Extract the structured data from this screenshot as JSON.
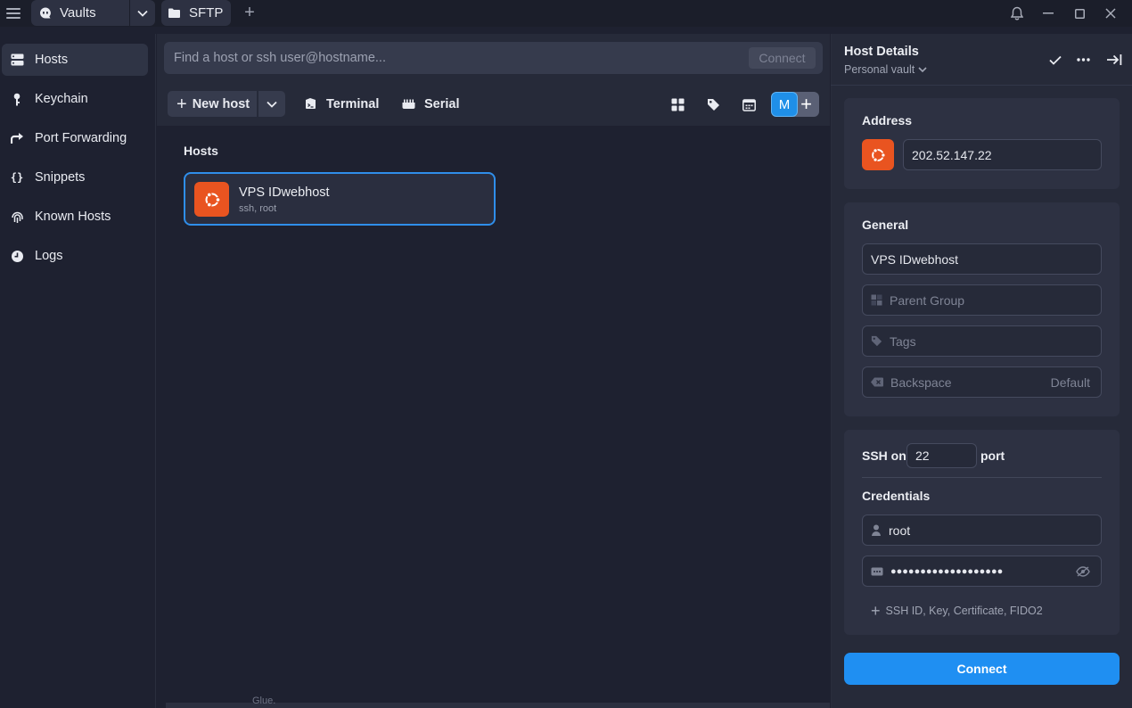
{
  "titlebar": {
    "tabs": [
      {
        "label": "Vaults",
        "icon": "vault-icon"
      },
      {
        "label": "SFTP",
        "icon": "folder-icon"
      }
    ]
  },
  "sidebar": {
    "items": [
      {
        "label": "Hosts",
        "icon": "hosts-grid-icon",
        "active": true
      },
      {
        "label": "Keychain",
        "icon": "key-icon"
      },
      {
        "label": "Port Forwarding",
        "icon": "port-forward-icon"
      },
      {
        "label": "Snippets",
        "icon": "braces-icon"
      },
      {
        "label": "Known Hosts",
        "icon": "fingerprint-icon"
      },
      {
        "label": "Logs",
        "icon": "clock-icon"
      }
    ]
  },
  "main": {
    "search": {
      "placeholder": "Find a host or ssh user@hostname...",
      "connect_label": "Connect"
    },
    "toolbar": {
      "new_host": "New host",
      "terminal": "Terminal",
      "serial": "Serial",
      "avatar_initial": "M"
    },
    "section_title": "Hosts",
    "hosts": [
      {
        "name": "VPS IDwebhost",
        "sub": "ssh, root",
        "os": "ubuntu"
      }
    ],
    "bottom_ghost": "Glue."
  },
  "panel": {
    "title": "Host Details",
    "vault": "Personal vault",
    "address": {
      "label": "Address",
      "value": "202.52.147.22"
    },
    "general": {
      "label": "General",
      "name": "VPS IDwebhost",
      "parent_group": "Parent Group",
      "tags": "Tags",
      "backspace": "Backspace",
      "backspace_value": "Default"
    },
    "ssh": {
      "ssh_on": "SSH on",
      "port": "22",
      "port_suffix": "port",
      "credentials": "Credentials",
      "username": "root",
      "password_mask": "●●●●●●●●●●●●●●●●●●●",
      "add_credential": "SSH ID, Key, Certificate, FIDO2"
    },
    "connect_label": "Connect"
  },
  "colors": {
    "accent": "#1f8ff2",
    "ubuntu": "#e95420",
    "background": "#1e2130",
    "panel": "#262a39"
  }
}
